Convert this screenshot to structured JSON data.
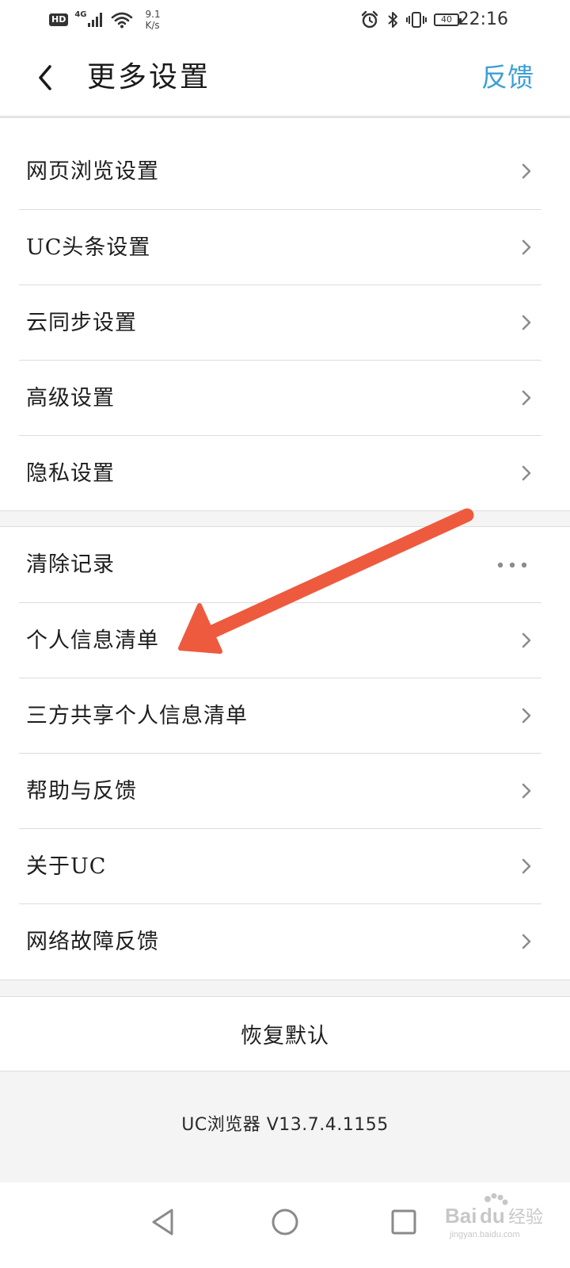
{
  "status_bar": {
    "hd": "HD",
    "network": "4G",
    "speed_value": "9.1",
    "speed_unit": "K/s",
    "battery": "40",
    "time": "22:16"
  },
  "header": {
    "title": "更多设置",
    "feedback": "反馈"
  },
  "group_1": [
    {
      "label": "网页浏览设置",
      "action": "chevron"
    },
    {
      "label": "UC头条设置",
      "action": "chevron"
    },
    {
      "label": "云同步设置",
      "action": "chevron"
    },
    {
      "label": "高级设置",
      "action": "chevron"
    },
    {
      "label": "隐私设置",
      "action": "chevron"
    }
  ],
  "group_2": [
    {
      "label": "清除记录",
      "action": "more"
    },
    {
      "label": "个人信息清单",
      "action": "chevron"
    },
    {
      "label": "三方共享个人信息清单",
      "action": "chevron"
    },
    {
      "label": "帮助与反馈",
      "action": "chevron"
    },
    {
      "label": "关于UC",
      "action": "chevron"
    },
    {
      "label": "网络故障反馈",
      "action": "chevron"
    }
  ],
  "restore_label": "恢复默认",
  "version": "UC浏览器 V13.7.4.1155",
  "watermark": "Baidu经验 jingyan.baidu.com",
  "colors": {
    "accent": "#3b9fd6",
    "arrow": "#ee5a3e",
    "background": "#f4f4f4"
  },
  "icons": [
    "back-chevron-icon",
    "chevron-right-icon",
    "more-dots-icon",
    "nav-back-icon",
    "nav-home-icon",
    "nav-recents-icon"
  ]
}
